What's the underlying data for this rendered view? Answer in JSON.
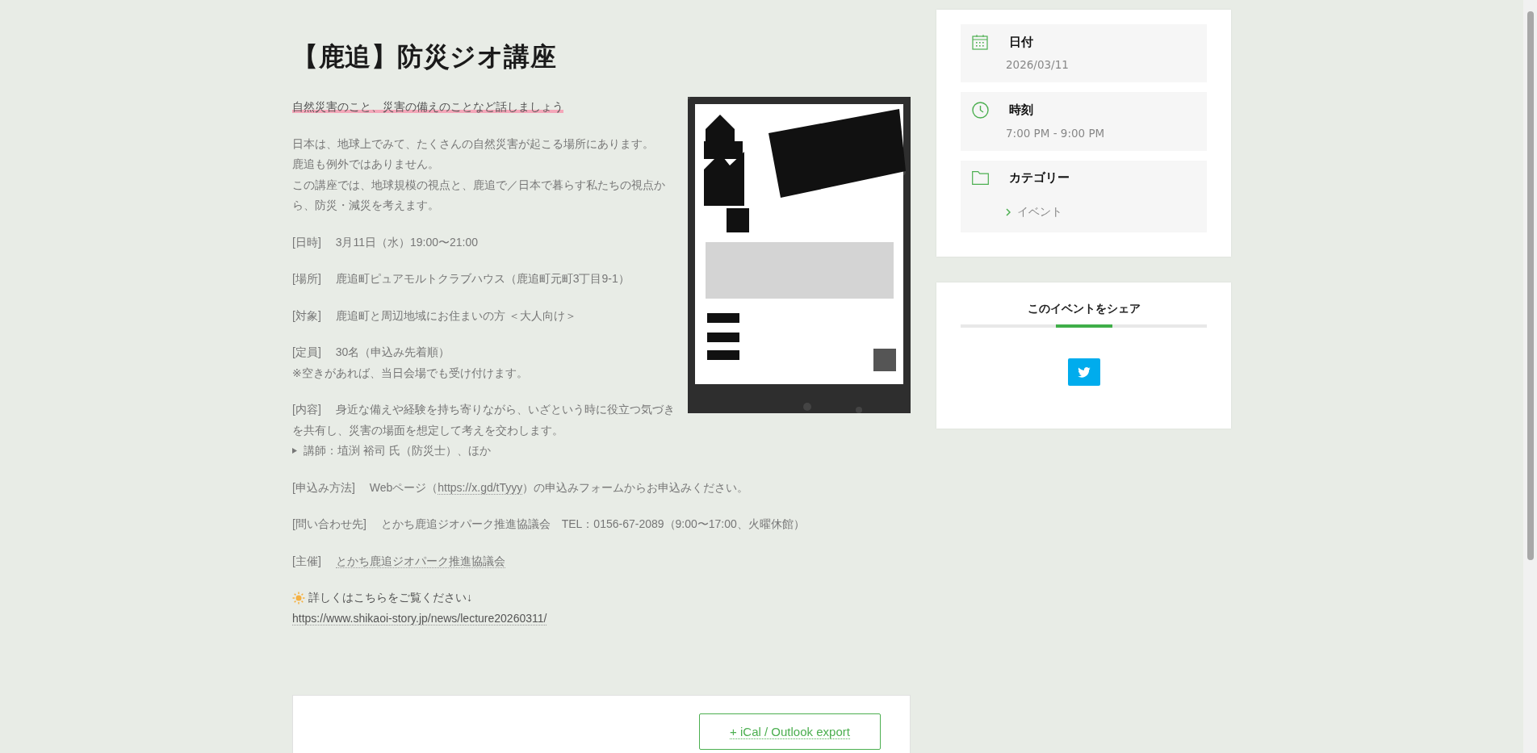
{
  "title": "【鹿追】防災ジオ講座",
  "tagline": "自然災害のこと、災害の備えのことなど話しましょう",
  "intro": [
    "日本は、地球上でみて、たくさんの自然災害が起こる場所にあります。",
    "鹿追も例外ではありません。",
    "この講座では、地球規模の視点と、鹿追で／日本で暮らす私たちの視点から、防災・減災を考えます。"
  ],
  "details": [
    {
      "label": "[日時]",
      "parts": [
        {
          "kind": "text",
          "text": "3月11日（水）19:00〜21:00"
        }
      ]
    },
    {
      "label": "[場所]",
      "parts": [
        {
          "kind": "text",
          "text": "鹿追町ピュアモルトクラブハウス（鹿追町元町3丁目9-1）"
        }
      ]
    },
    {
      "label": "[対象]",
      "parts": [
        {
          "kind": "text",
          "text": "鹿追町と周辺地域にお住まいの方 ＜大人向け＞"
        }
      ]
    },
    {
      "label": "[定員]",
      "parts": [
        {
          "kind": "text",
          "text": "30名（申込み先着順）"
        }
      ],
      "note": "※空きがあれば、当日会場でも受け付けます。"
    },
    {
      "label": "[内容]",
      "parts": [
        {
          "kind": "text",
          "text": "身近な備えや経験を持ち寄りながら、いざという時に役立つ気づきを共有し、災害の場面を想定して考えを交わします。"
        }
      ],
      "bullet": "講師：埴渕 裕司 氏（防災士）、ほか"
    },
    {
      "label": "[申込み方法]",
      "parts": [
        {
          "kind": "text",
          "text": "Webページ（"
        },
        {
          "kind": "link",
          "text": "https://x.gd/tTyyy"
        },
        {
          "kind": "text",
          "text": "）の申込みフォームからお申込みください。"
        }
      ]
    },
    {
      "label": "[問い合わせ先]",
      "parts": [
        {
          "kind": "text",
          "text": "とかち鹿追ジオパーク推進協議会　TEL：0156-67-2089（9:00〜17:00、火曜休館）"
        }
      ]
    },
    {
      "label": "[主催]",
      "parts": [
        {
          "kind": "link",
          "text": "とかち鹿追ジオパーク推進協議会"
        }
      ]
    }
  ],
  "more": {
    "text": "詳しくはこちらをご覧ください↓",
    "link": "https://www.shikaoi-story.jp/news/lecture20260311/"
  },
  "export_button": "+ iCal / Outlook export",
  "sidebar": {
    "info": [
      {
        "kind": "date",
        "heading": "日付",
        "value": "2026/03/11"
      },
      {
        "kind": "time",
        "heading": "時刻",
        "value": "7:00 PM - 9:00 PM"
      },
      {
        "kind": "category",
        "heading": "カテゴリー",
        "links": [
          "イベント"
        ]
      }
    ],
    "share": {
      "heading": "このイベントをシェア",
      "buttons": [
        {
          "kind": "twitter"
        }
      ]
    }
  }
}
